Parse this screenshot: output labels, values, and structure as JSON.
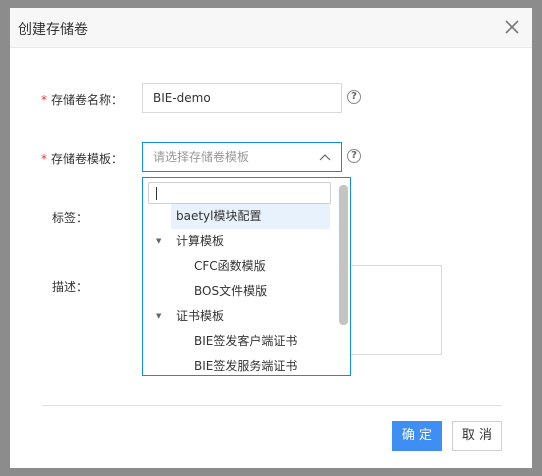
{
  "dialog": {
    "title": "创建存储卷"
  },
  "form": {
    "name": {
      "required": "*",
      "label": "存储卷名称：",
      "value": "BIE-demo"
    },
    "template": {
      "required": "*",
      "label": "存储卷模板：",
      "placeholder": "请选择存储卷模板"
    },
    "tags": {
      "label": "标签："
    },
    "description": {
      "label": "描述："
    },
    "help_glyph": "?"
  },
  "dropdown": {
    "search_value": "",
    "items": [
      {
        "label": "baetyl模块配置",
        "selected": true
      },
      {
        "label": "计算模板",
        "group": true
      },
      {
        "label": "CFC函数模版"
      },
      {
        "label": "BOS文件模版"
      },
      {
        "label": "证书模板",
        "group": true
      },
      {
        "label": "BIE签发客户端证书"
      },
      {
        "label": "BIE签发服务端证书"
      }
    ]
  },
  "footer": {
    "confirm_label": "确 定",
    "cancel_label": "取 消"
  },
  "colors": {
    "accent": "#108cee",
    "primary_button": "#3f8ef3",
    "required": "#e8362b",
    "selected_item": "#e7f2fd"
  },
  "icons": {
    "close": "close-icon",
    "help": "help-circle-icon",
    "arrow": "chevron-up-icon",
    "group_toggle": "triangle-down-icon"
  }
}
